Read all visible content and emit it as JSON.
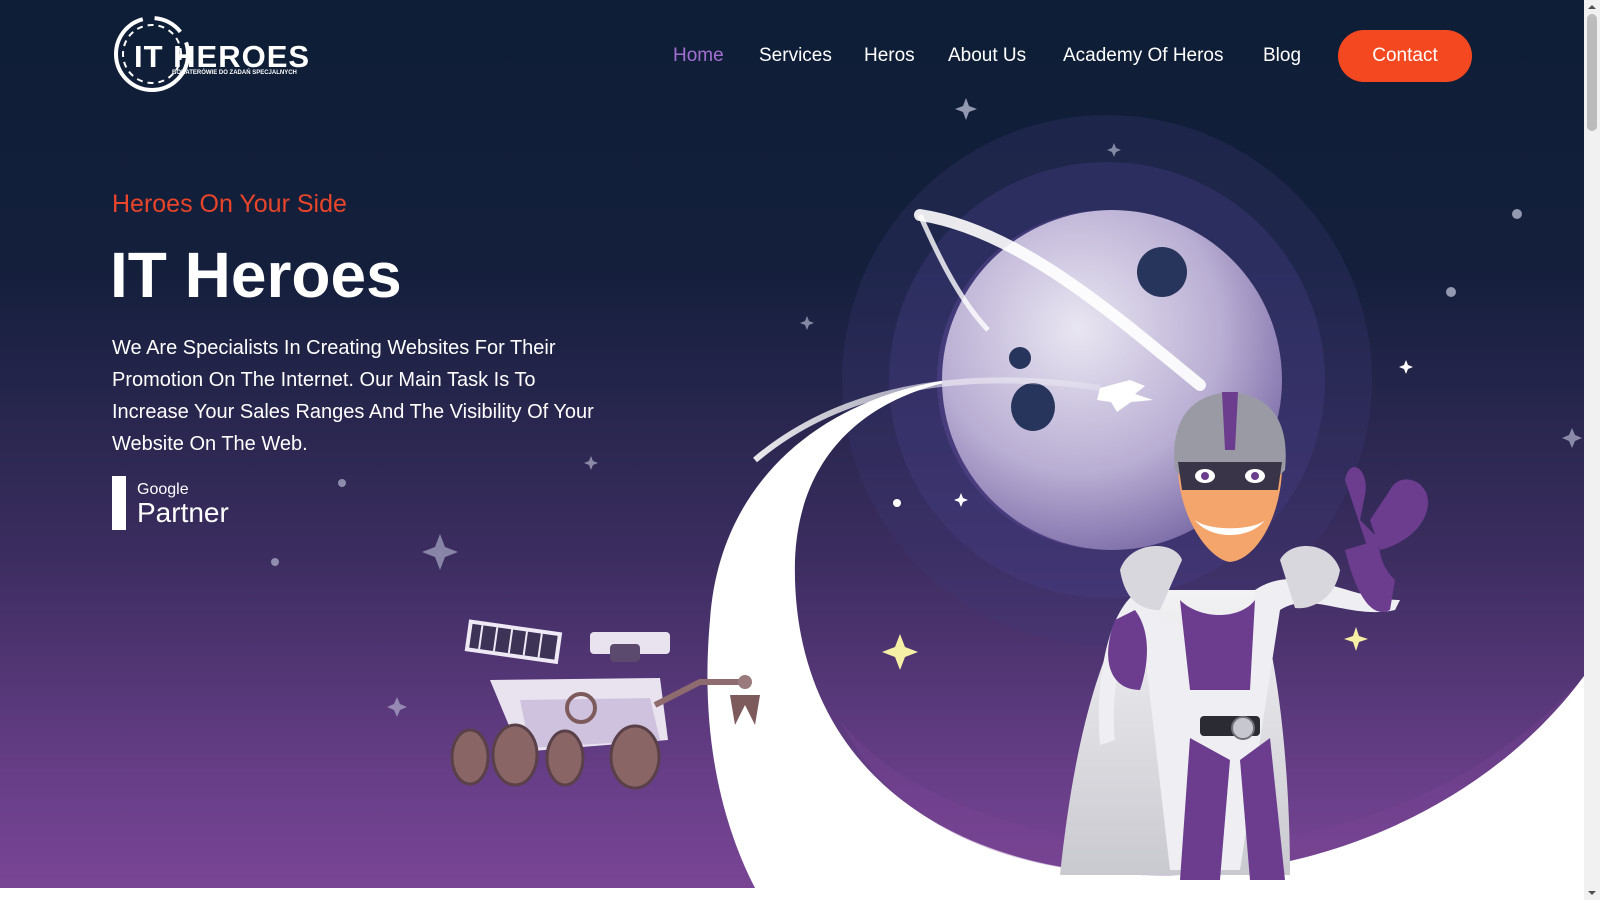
{
  "logo": {
    "main": "IT HEROES",
    "sub": "BOHATERÓWIE DO ZADAŃ SPECJALNYCH"
  },
  "nav": {
    "items": [
      {
        "label": "Home",
        "active": true
      },
      {
        "label": "Services"
      },
      {
        "label": "Heros"
      },
      {
        "label": "About Us"
      },
      {
        "label": "Academy Of Heros"
      },
      {
        "label": "Blog"
      }
    ],
    "contact_label": "Contact"
  },
  "hero": {
    "eyebrow": "Heroes On Your Side",
    "title": "IT Heroes",
    "description": "We Are Specialists In Creating Websites For Their Promotion On The Internet. Our Main Task Is To Increase Your Sales Ranges And The Visibility Of Your Website On The Web.",
    "badge": {
      "line1": "Google",
      "line2": "Partner"
    }
  },
  "colors": {
    "accent": "#f44820",
    "eyebrow": "#e8452a",
    "nav_active": "#a26fd1",
    "bg_top": "#0e1e36",
    "bg_bottom": "#7a4695"
  },
  "icons": {
    "scroll_up": "arrow-up-icon",
    "scroll_down": "arrow-down-icon"
  }
}
